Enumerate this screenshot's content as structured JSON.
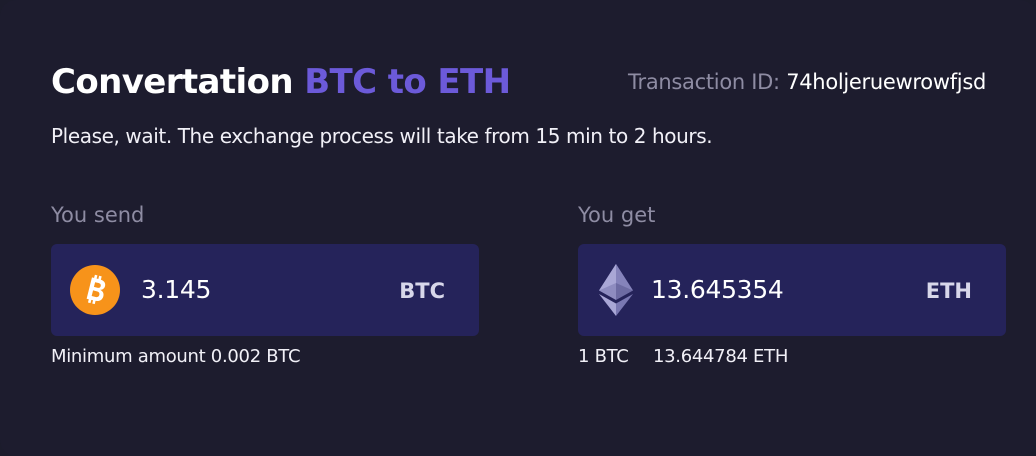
{
  "header": {
    "title_main": "Convertation",
    "title_accent": "BTC to ETH",
    "transaction_label": "Transaction ID:",
    "transaction_id": "74holjeruewrowfjsd",
    "subtitle": "Please, wait. The exchange process will take from 15 min to 2 hours."
  },
  "send": {
    "label": "You send",
    "amount": "3.145",
    "currency": "BTC",
    "icon": "bitcoin-icon",
    "minimum_label": "Minimum amount 0.002 BTC"
  },
  "get": {
    "label": "You get",
    "amount": "13.645354",
    "currency": "ETH",
    "icon": "ethereum-icon",
    "rate_from": "1 BTC",
    "rate_to": "13.644784 ETH"
  },
  "colors": {
    "background": "#1d1c2e",
    "panel": "#25235a",
    "accent": "#6c5ad9",
    "bitcoin": "#f7931a",
    "muted_text": "#8e8ca3"
  }
}
